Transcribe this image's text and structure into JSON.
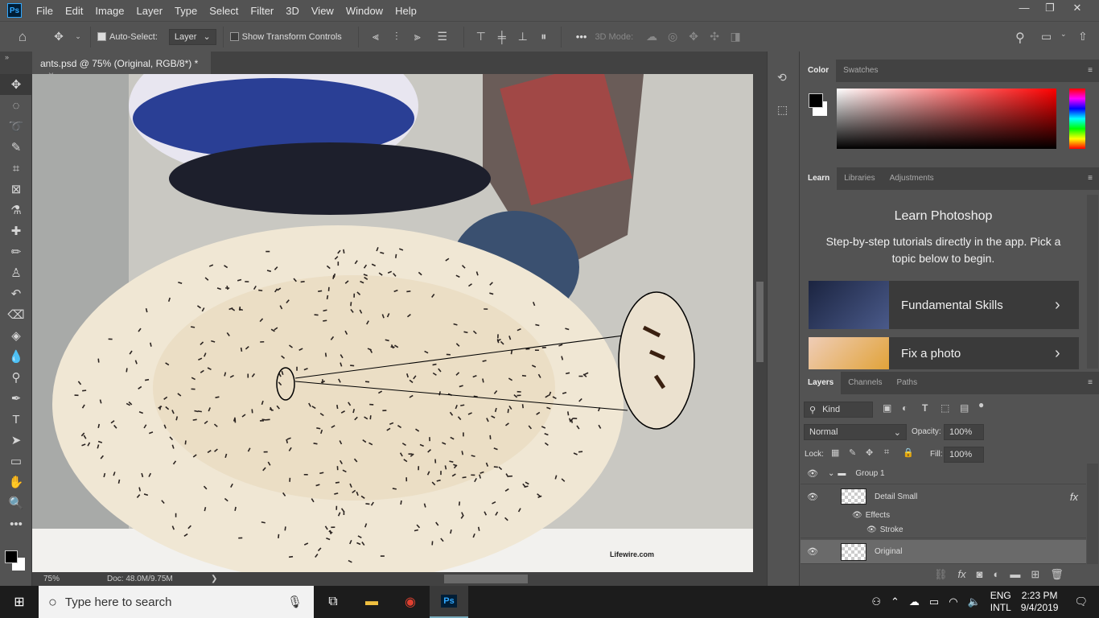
{
  "app": {
    "logo": "Ps",
    "menu": [
      "File",
      "Edit",
      "Image",
      "Layer",
      "Type",
      "Select",
      "Filter",
      "3D",
      "View",
      "Window",
      "Help"
    ],
    "window_controls": [
      "minimize",
      "restore",
      "close"
    ]
  },
  "options": {
    "auto_select_label": "Auto-Select:",
    "auto_select_checked": true,
    "auto_select_target": "Layer",
    "show_transform_label": "Show Transform Controls",
    "show_transform_checked": false,
    "more": "•••",
    "mode_3d": "3D Mode:"
  },
  "document": {
    "tab_title": "ants.psd @ 75% (Original, RGB/8*) *",
    "close": "×",
    "watermark": "Lifewire.com"
  },
  "status": {
    "zoom": "75%",
    "doc": "Doc: 48.0M/9.75M",
    "arrow": "❯"
  },
  "color_panel": {
    "tabs": [
      "Color",
      "Swatches"
    ],
    "active": "Color",
    "foreground": "#000000",
    "background": "#ffffff",
    "hue": "#ff0000"
  },
  "learn_panel": {
    "tabs": [
      "Learn",
      "Libraries",
      "Adjustments"
    ],
    "active": "Learn",
    "title": "Learn Photoshop",
    "subtitle": "Step-by-step tutorials directly in the app. Pick a topic below to begin.",
    "cards": [
      {
        "label": "Fundamental Skills"
      },
      {
        "label": "Fix a photo"
      }
    ]
  },
  "layers_panel": {
    "tabs": [
      "Layers",
      "Channels",
      "Paths"
    ],
    "active": "Layers",
    "filter": "Kind",
    "blend_mode": "Normal",
    "opacity_label": "Opacity:",
    "opacity": "100%",
    "lock_label": "Lock:",
    "fill_label": "Fill:",
    "fill": "100%",
    "layers": [
      {
        "name": "Group 1",
        "type": "group"
      },
      {
        "name": "Detail Small",
        "fx": "fx"
      },
      {
        "name": "Effects"
      },
      {
        "name": "Stroke"
      },
      {
        "name": "Original",
        "selected": true
      }
    ]
  },
  "taskbar": {
    "search_placeholder": "Type here to search",
    "lang": "ENG",
    "layout": "INTL",
    "time": "2:23 PM",
    "date": "9/4/2019"
  }
}
